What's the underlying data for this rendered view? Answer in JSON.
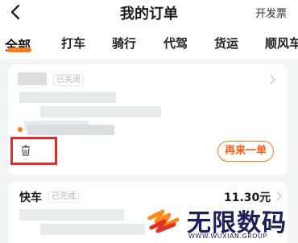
{
  "header": {
    "title": "我的订单",
    "invoice_label": "开发票"
  },
  "tabs": [
    {
      "label": "全部",
      "active": true
    },
    {
      "label": "打车"
    },
    {
      "label": "骑行"
    },
    {
      "label": "代驾"
    },
    {
      "label": "货运"
    },
    {
      "label": "顺风车"
    }
  ],
  "orders": [
    {
      "service": "",
      "status": "已关闭",
      "reorder_label": "再来一单",
      "has_delete": true
    },
    {
      "service": "快车",
      "status": "已完成",
      "price": "11.30元"
    }
  ],
  "watermark": {
    "name": "无限数码",
    "url": "WWW.WUXIAN.GROUP"
  },
  "colors": {
    "accent": "#ff7a1a",
    "highlight_box": "#e02d2d",
    "watermark": "#1e1e5a"
  }
}
